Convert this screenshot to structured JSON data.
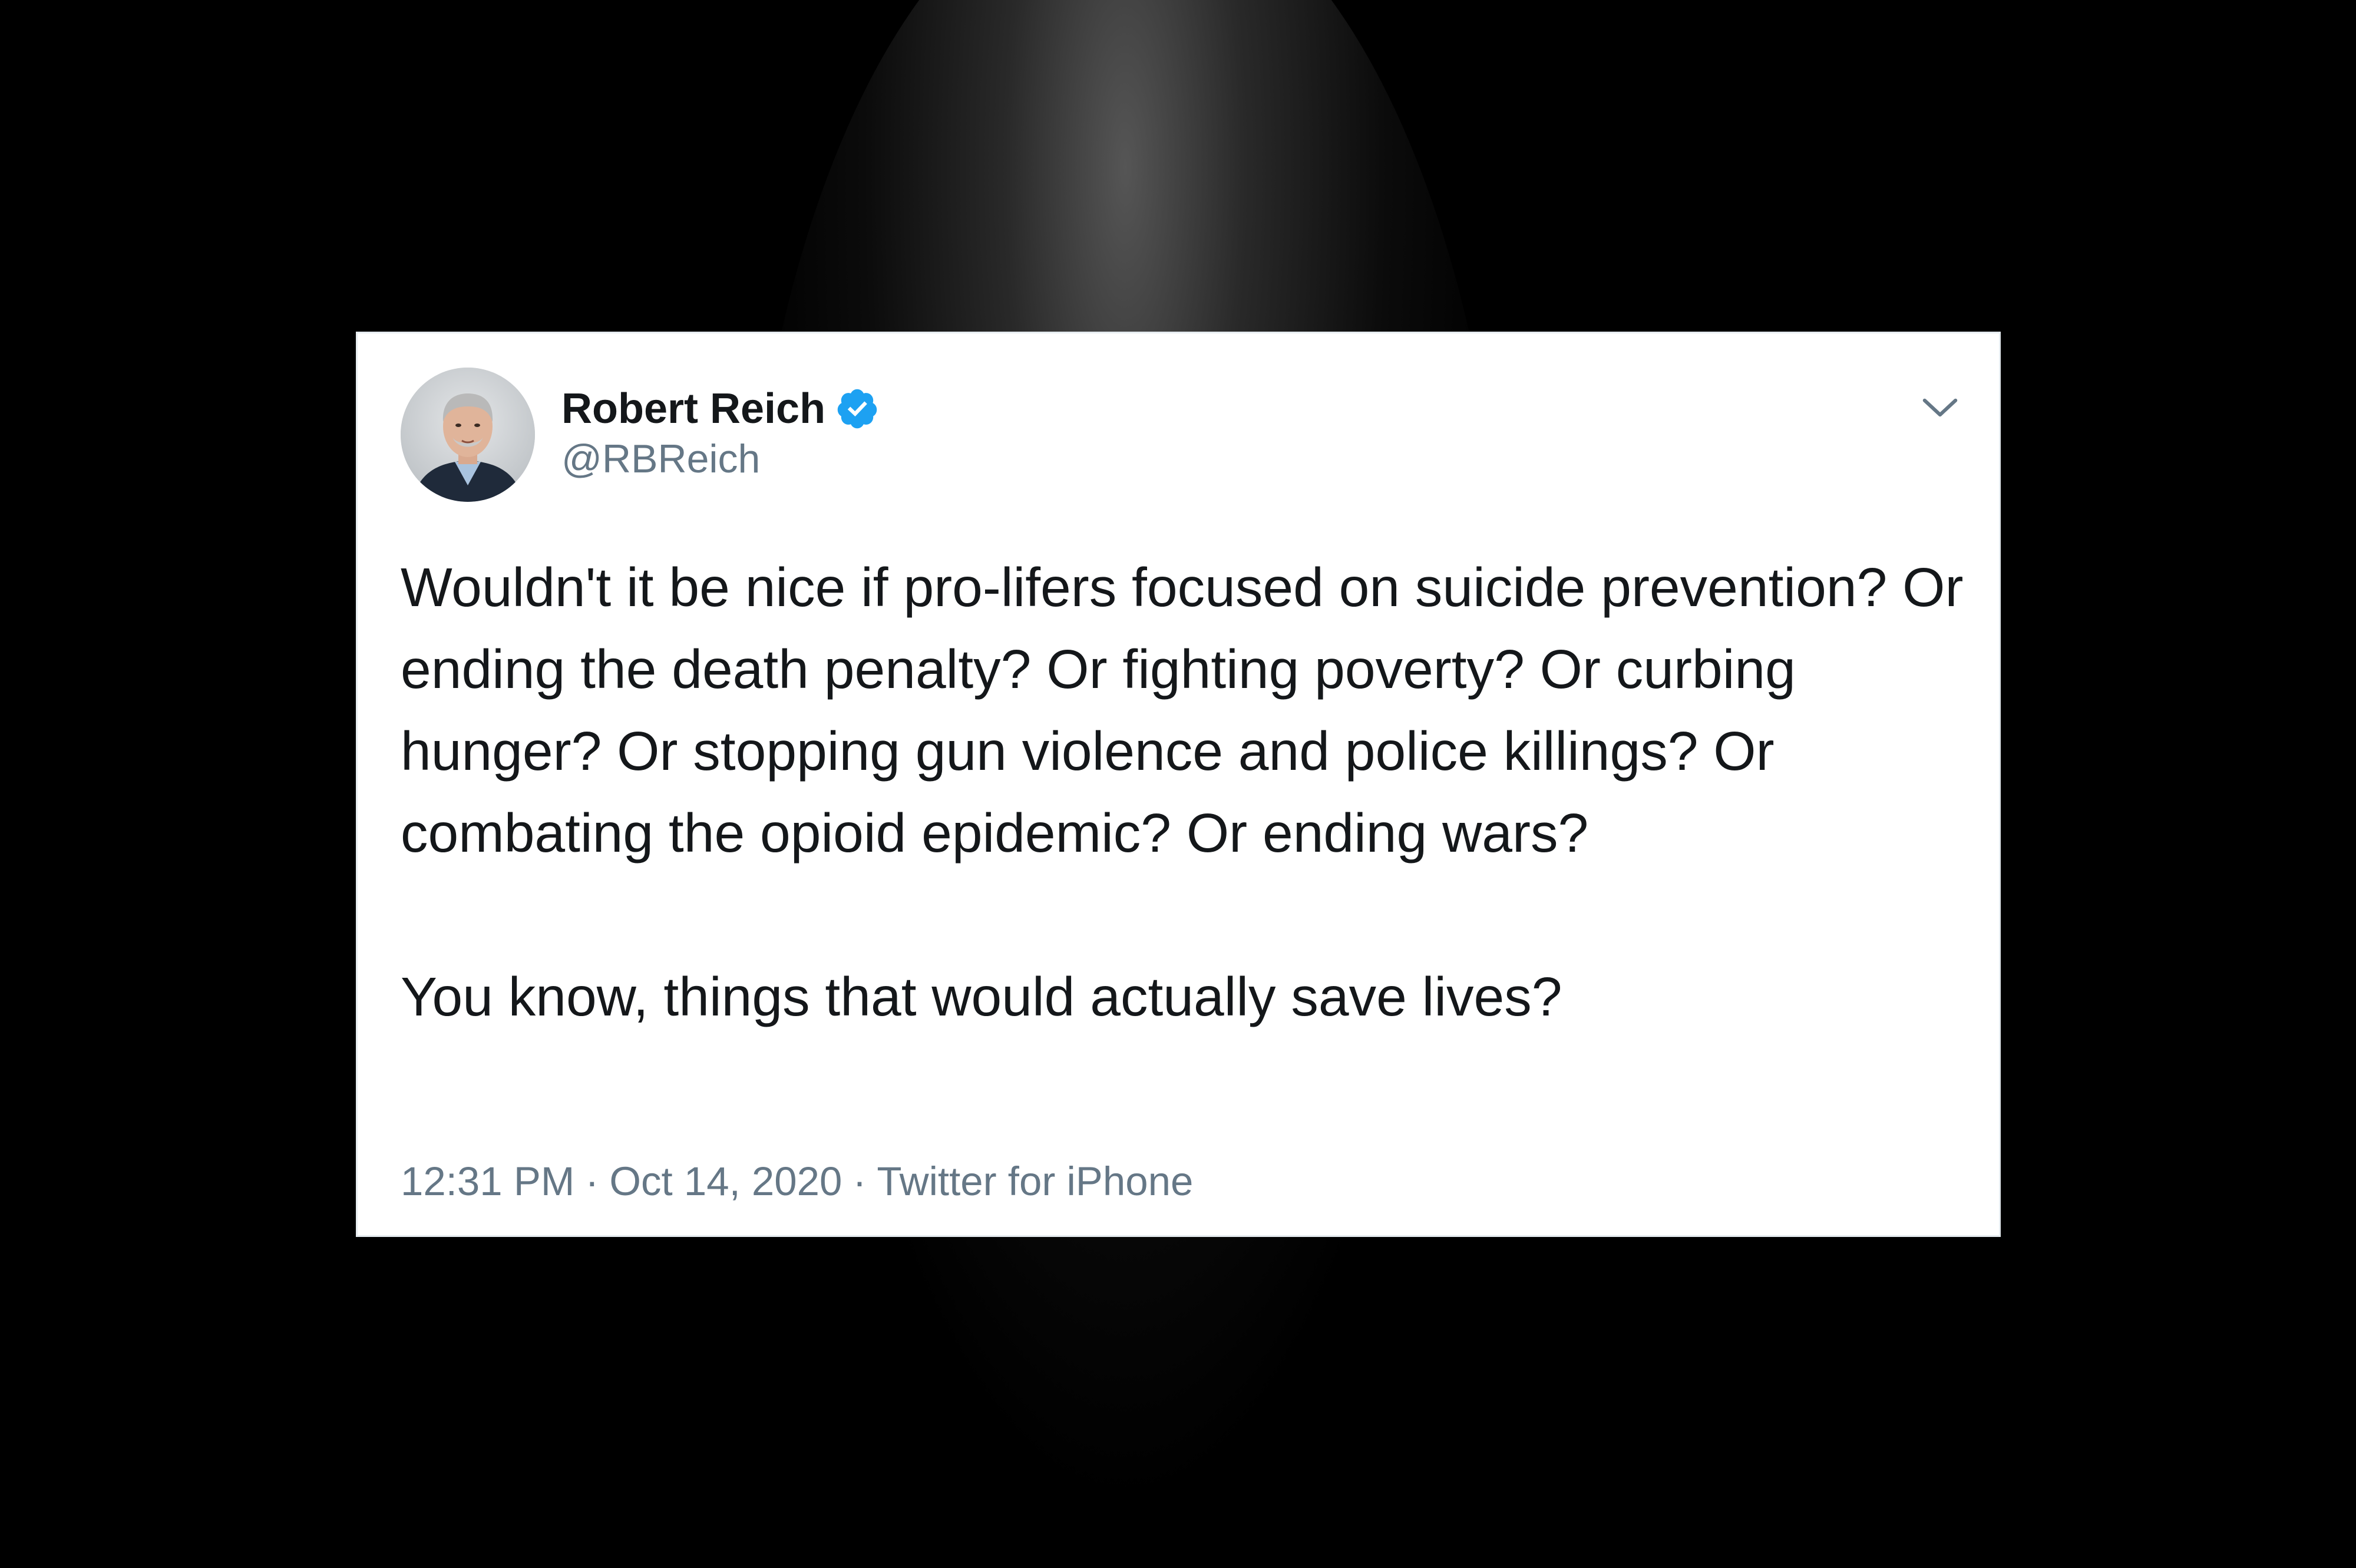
{
  "tweet": {
    "author": {
      "display_name": "Robert Reich",
      "handle": "@RBReich",
      "verified": true
    },
    "body": {
      "paragraph_1": "Wouldn't it be nice if pro-lifers focused on suicide prevention? Or ending the death penalty? Or fighting poverty? Or curbing hunger? Or stopping gun violence and police killings? Or combating the opioid epidemic? Or ending wars?",
      "paragraph_2": "You know, things that would actually save lives?"
    },
    "meta": {
      "time": "12:31 PM",
      "separator": "·",
      "date": "Oct 14, 2020",
      "source": "Twitter for iPhone"
    }
  },
  "icons": {
    "verified": "verified-badge-icon",
    "menu": "chevron-down-icon"
  },
  "colors": {
    "background": "#000000",
    "card": "#ffffff",
    "text_primary": "#14171a",
    "text_secondary": "#657786",
    "verified_blue": "#1da1f2"
  }
}
